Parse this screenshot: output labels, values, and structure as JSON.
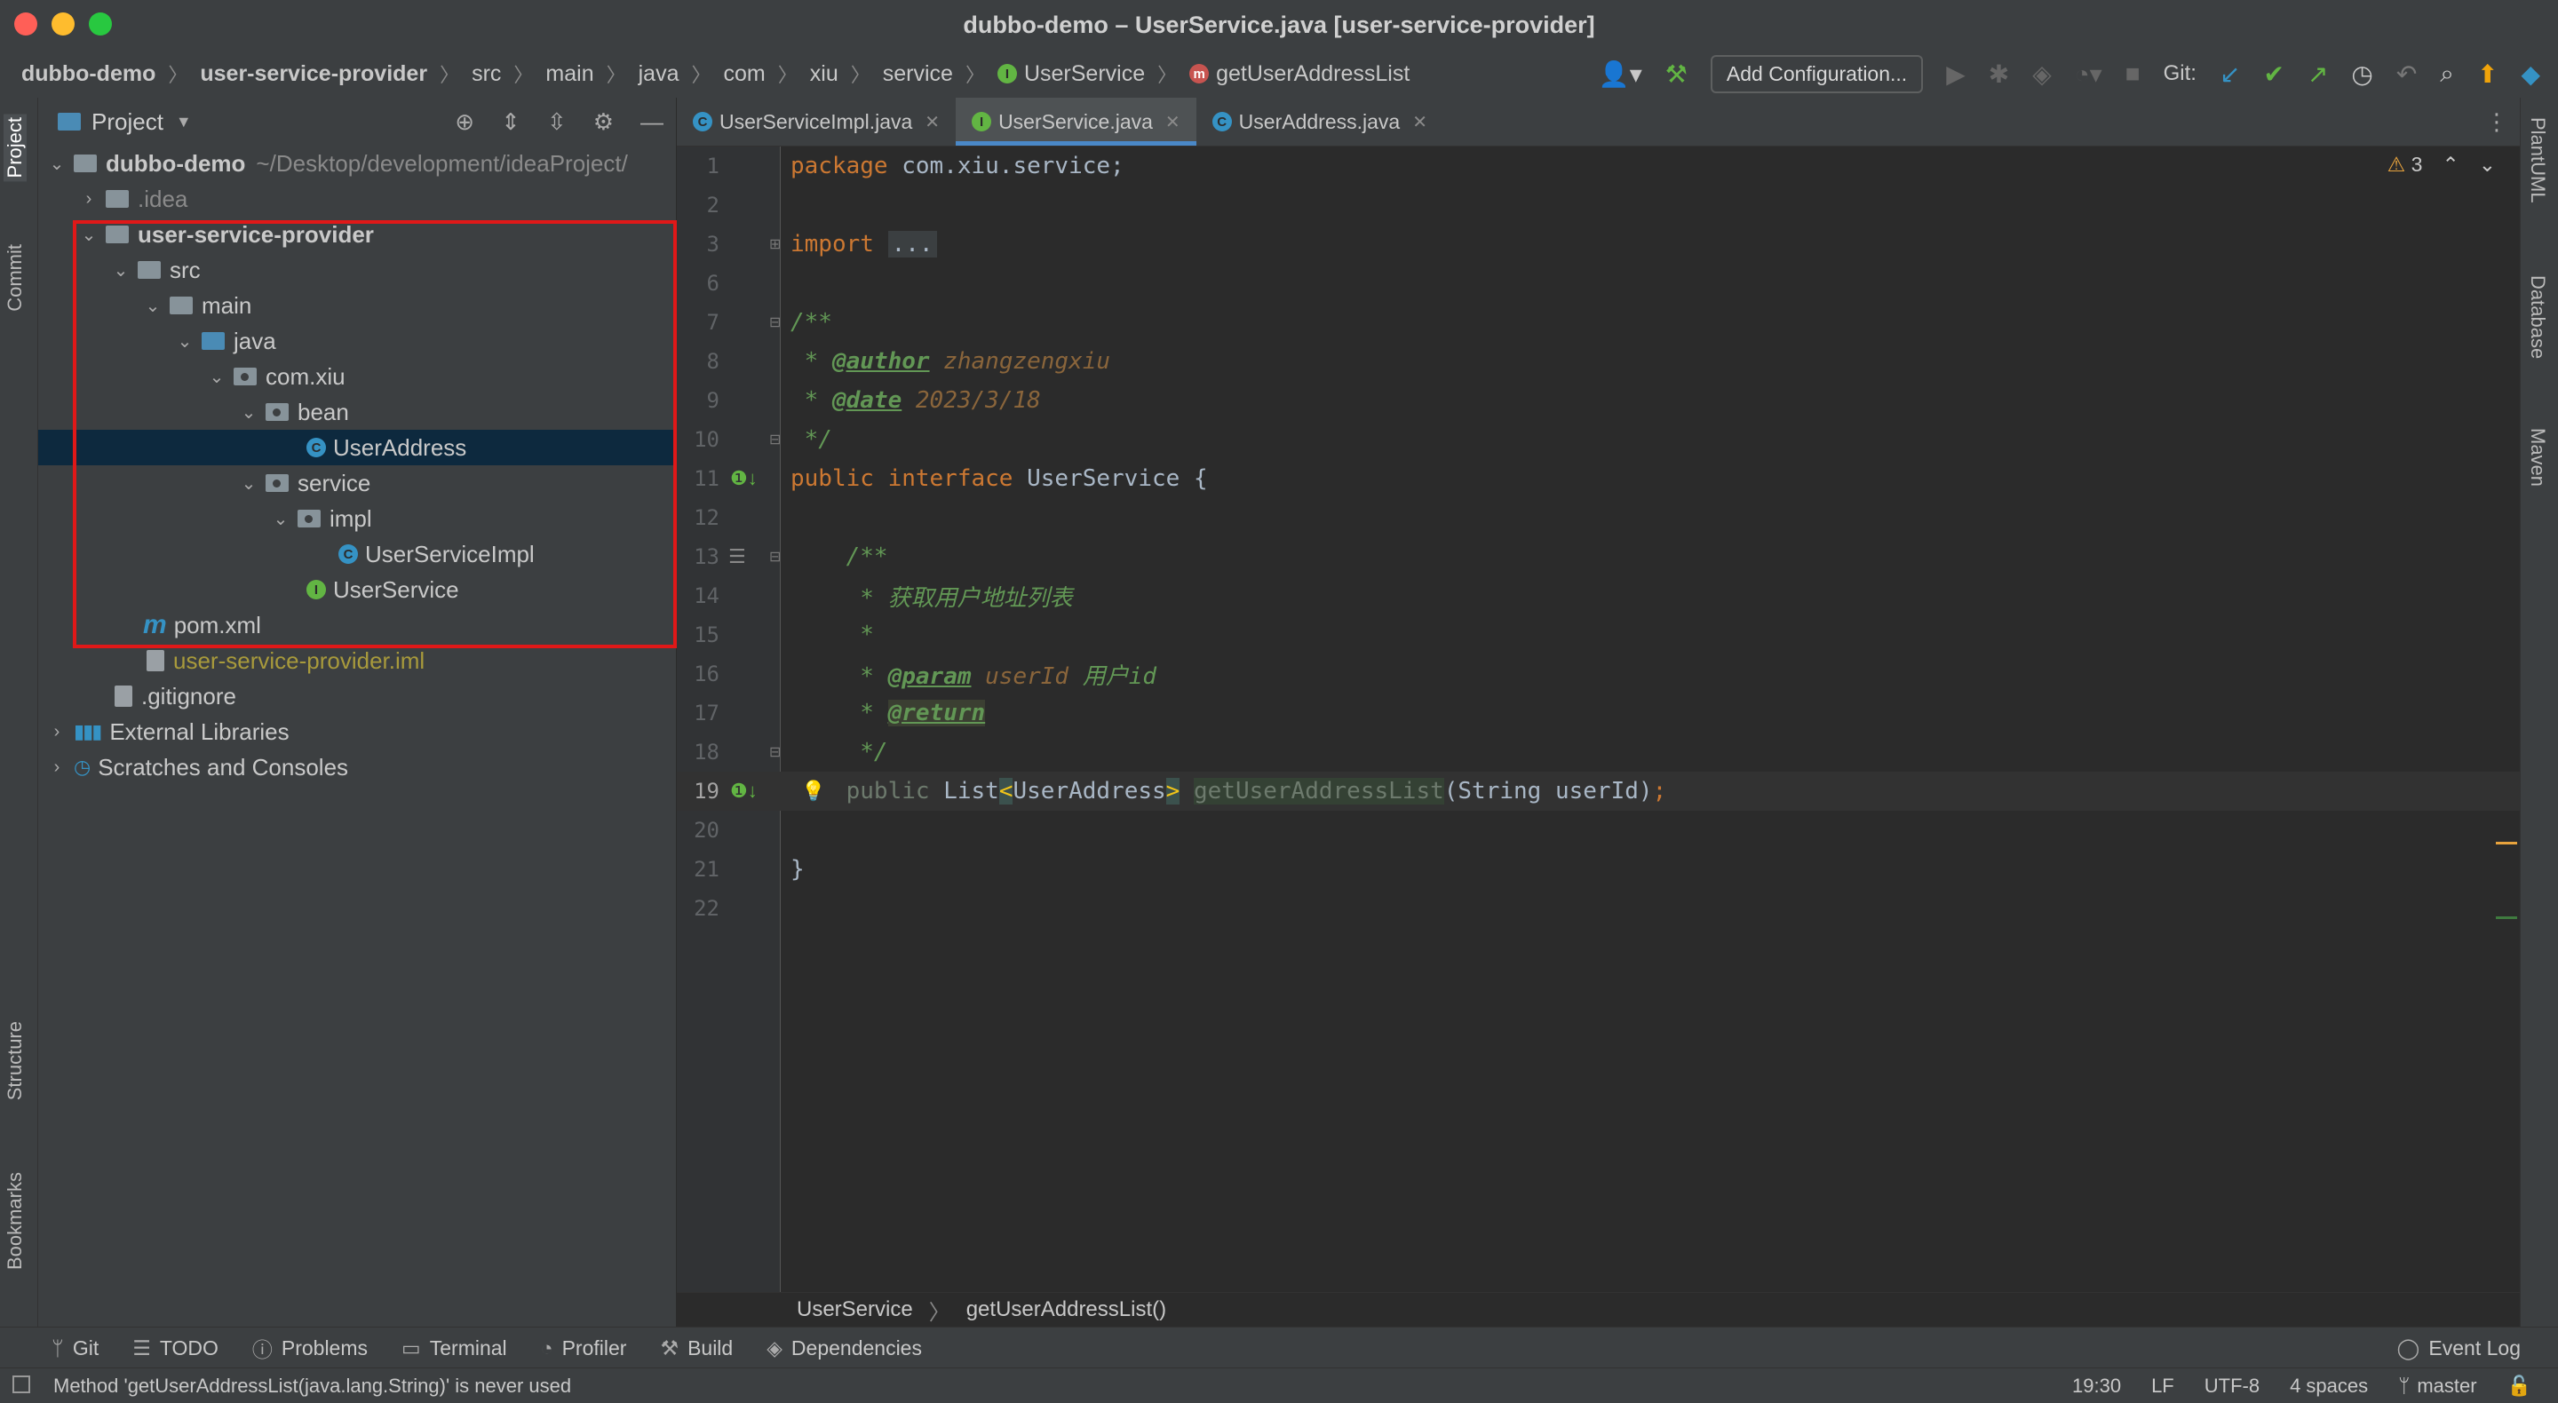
{
  "window": {
    "title": "dubbo-demo – UserService.java [user-service-provider]"
  },
  "navbar": {
    "breadcrumbs": [
      "dubbo-demo",
      "user-service-provider",
      "src",
      "main",
      "java",
      "com",
      "xiu",
      "service",
      "UserService",
      "getUserAddressList"
    ],
    "add_configuration": "Add Configuration...",
    "git_label": "Git:"
  },
  "left_tabs": {
    "project": "Project",
    "commit": "Commit",
    "structure": "Structure",
    "bookmarks": "Bookmarks"
  },
  "right_tabs": {
    "plantuml": "PlantUML",
    "database": "Database",
    "maven": "Maven"
  },
  "project_panel": {
    "title": "Project",
    "root": {
      "name": "dubbo-demo",
      "path": "~/Desktop/development/ideaProject/"
    },
    "items": {
      "idea": ".idea",
      "module": "user-service-provider",
      "src": "src",
      "main": "main",
      "java": "java",
      "pkg": "com.xiu",
      "bean": "bean",
      "user_address": "UserAddress",
      "service": "service",
      "impl": "impl",
      "user_service_impl": "UserServiceImpl",
      "user_service": "UserService",
      "pom": "pom.xml",
      "iml": "user-service-provider.iml",
      "gitignore": ".gitignore",
      "external_libraries": "External Libraries",
      "scratches": "Scratches and Consoles"
    }
  },
  "editor": {
    "tabs": [
      "UserServiceImpl.java",
      "UserService.java",
      "UserAddress.java"
    ],
    "warning_count": "3",
    "line_numbers": [
      "1",
      "2",
      "3",
      "6",
      "7",
      "8",
      "9",
      "10",
      "11",
      "12",
      "13",
      "14",
      "15",
      "16",
      "17",
      "18",
      "19",
      "20",
      "21",
      "22"
    ],
    "code": {
      "l1_kw": "package",
      "l1_rest": " com.xiu.service;",
      "l3_kw": "import",
      "l3_fold": "...",
      "l7": "/**",
      "l8_pre": " * ",
      "l8_tag": "@author",
      "l8_val": " zhangzengxiu",
      "l9_pre": " * ",
      "l9_tag": "@date",
      "l9_val": " 2023/3/18",
      "l10": " */",
      "l11_kw": "public interface",
      "l11_rest": " UserService {",
      "l13": "    /**",
      "l14": "     * 获取用户地址列表",
      "l15": "     *",
      "l16_pre": "     * ",
      "l16_tag": "@param",
      "l16_val": " userId",
      "l16_desc": " 用户id",
      "l17_pre": "     * ",
      "l17_tag": "@return",
      "l18": "     */",
      "l19_indent": "    ",
      "l19_kw": "public",
      "l19_type1": " List",
      "l19_lt": "<",
      "l19_type2": "UserAddress",
      "l19_gt": ">",
      "l19_sp": " ",
      "l19_method": "getUserAddressList",
      "l19_params": "(String userId)",
      "l19_semi": ";",
      "l21": "}"
    },
    "bottom_breadcrumb": [
      "UserService",
      "getUserAddressList()"
    ]
  },
  "tool_windows": [
    "Git",
    "TODO",
    "Problems",
    "Terminal",
    "Profiler",
    "Build",
    "Dependencies"
  ],
  "event_log": "Event Log",
  "status": {
    "message": "Method 'getUserAddressList(java.lang.String)' is never used",
    "position": "19:30",
    "line_sep": "LF",
    "encoding": "UTF-8",
    "indent": "4 spaces",
    "branch": "master"
  },
  "colors": {
    "selection": "#0d293e",
    "highlight_box": "#e01818",
    "accent": "#4a88c7"
  }
}
